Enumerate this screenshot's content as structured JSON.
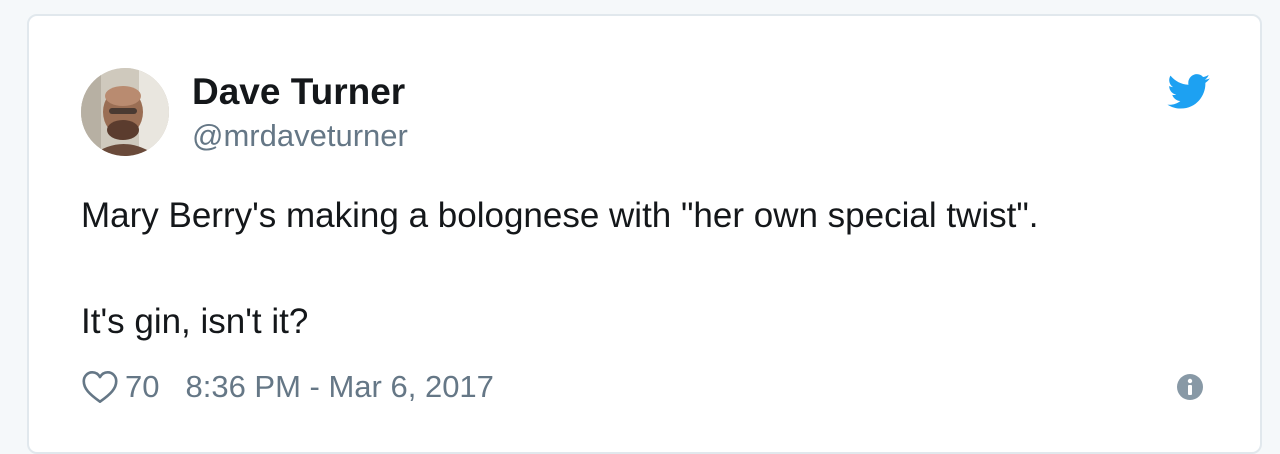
{
  "tweet": {
    "author_name": "Dave Turner",
    "author_handle": "@mrdaveturner",
    "text_line1": "Mary Berry's making a bolognese with \"her own special twist\".",
    "text_line2": "It's gin, isn't it?",
    "like_count": "70",
    "timestamp": "8:36 PM - Mar 6, 2017"
  },
  "icons": {
    "brand": "twitter-bird-icon",
    "like": "heart-outline-icon",
    "info": "info-circle-icon"
  },
  "colors": {
    "brand": "#1da1f2",
    "text": "#14171a",
    "secondary": "#657786",
    "border": "#e1e8ed"
  }
}
